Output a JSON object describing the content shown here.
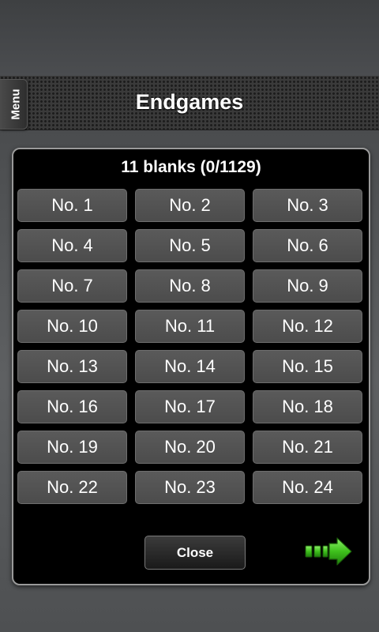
{
  "header": {
    "title": "Endgames",
    "menu_label": "Menu"
  },
  "dialog": {
    "title": "11 blanks (0/1129)",
    "levels": [
      "No. 1",
      "No. 2",
      "No. 3",
      "No. 4",
      "No. 5",
      "No. 6",
      "No. 7",
      "No. 8",
      "No. 9",
      "No. 10",
      "No. 11",
      "No. 12",
      "No. 13",
      "No. 14",
      "No. 15",
      "No. 16",
      "No. 17",
      "No. 18",
      "No. 19",
      "No. 20",
      "No. 21",
      "No. 22",
      "No. 23",
      "No. 24"
    ],
    "close_label": "Close",
    "next_icon": "green-arrow-right-icon"
  },
  "colors": {
    "arrow_green": "#3ec01c",
    "button_gray": "#525252",
    "dialog_bg": "#000000"
  }
}
